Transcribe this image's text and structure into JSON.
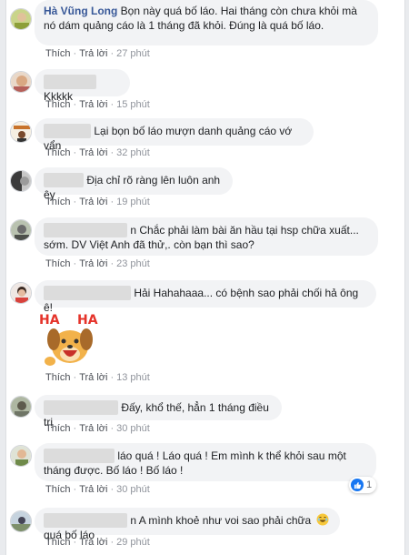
{
  "action_labels": {
    "like": "Thích",
    "reply": "Trả lời"
  },
  "comments": [
    {
      "author": "Hà Vũng Long",
      "text": "Bọn này quá bố láo. Hai tháng còn chưa khỏi mà nó dám quảng cáo là 1 tháng đã khỏi. Đúng là quá bố láo.",
      "time": "27 phút"
    },
    {
      "author": "",
      "text": "Kkkkk",
      "time": "15 phút"
    },
    {
      "author": "",
      "text": "Lại bọn bố láo mượn danh quảng cáo vớ vẩn",
      "time": "32 phút"
    },
    {
      "author": "",
      "text": "Địa chỉ rõ ràng lên luôn anh êy",
      "time": "19 phút"
    },
    {
      "author": "",
      "text": "n Chắc phải làm bài ăn hầu tại hsp chữa xuất... sớm. DV Việt Anh đã thử,. còn bạn thì sao?",
      "time": "23 phút"
    },
    {
      "author": "",
      "text": "Hải Hahahaaa... có bệnh sao phải chối hả ông ê!",
      "time": "13 phút",
      "sticker": {
        "word_left": "HA",
        "word_right": "HA"
      }
    },
    {
      "author": "",
      "text": "Đấy, khổ thế, hẳn 1 tháng điều trị",
      "time": "30 phút"
    },
    {
      "author": "",
      "text": "láo quá ! Láo quá ! Em mình k thể khỏi sau một tháng được. Bố láo ! Bố láo !",
      "time": "30 phút",
      "reactions": {
        "icon": "thumbs-up-icon",
        "count": "1",
        "color": "#1877f2"
      }
    },
    {
      "author": "",
      "text": "n A mình khoẻ như voi sao phải chữa",
      "text_after_emoji": "quá bố láo",
      "emoji": "laughing-face-icon",
      "time": "29 phút"
    }
  ]
}
